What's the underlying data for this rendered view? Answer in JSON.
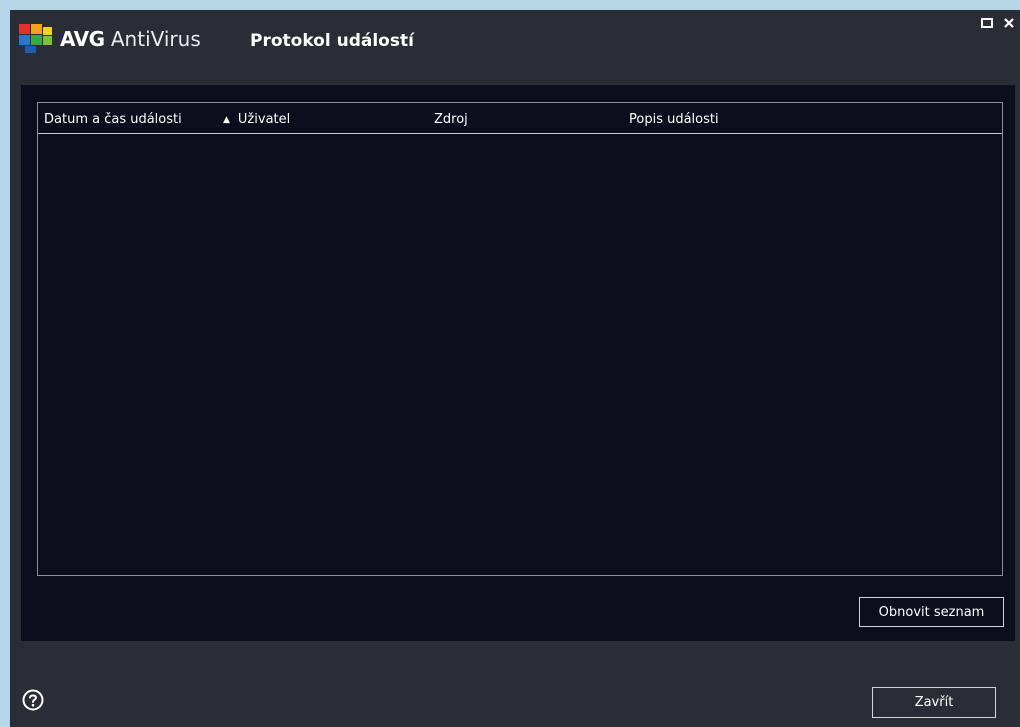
{
  "app": {
    "brand_bold": "AVG",
    "brand_light": " AntiVirus",
    "title": "Protokol událostí"
  },
  "window_controls": {
    "restore_icon": "restore-icon",
    "close_icon": "close-icon"
  },
  "table": {
    "columns": [
      {
        "label": "Datum a čas události"
      },
      {
        "label": "Uživatel",
        "sorted": "ascending"
      },
      {
        "label": "Zdroj"
      },
      {
        "label": "Popis události"
      }
    ],
    "rows": []
  },
  "buttons": {
    "refresh": "Obnovit seznam",
    "close": "Zavřít"
  },
  "colors": {
    "window_bg": "#2a2d35",
    "panel_bg": "#0b0e1d",
    "desktop_bg": "#b7d7e9",
    "text": "#ffffff"
  }
}
